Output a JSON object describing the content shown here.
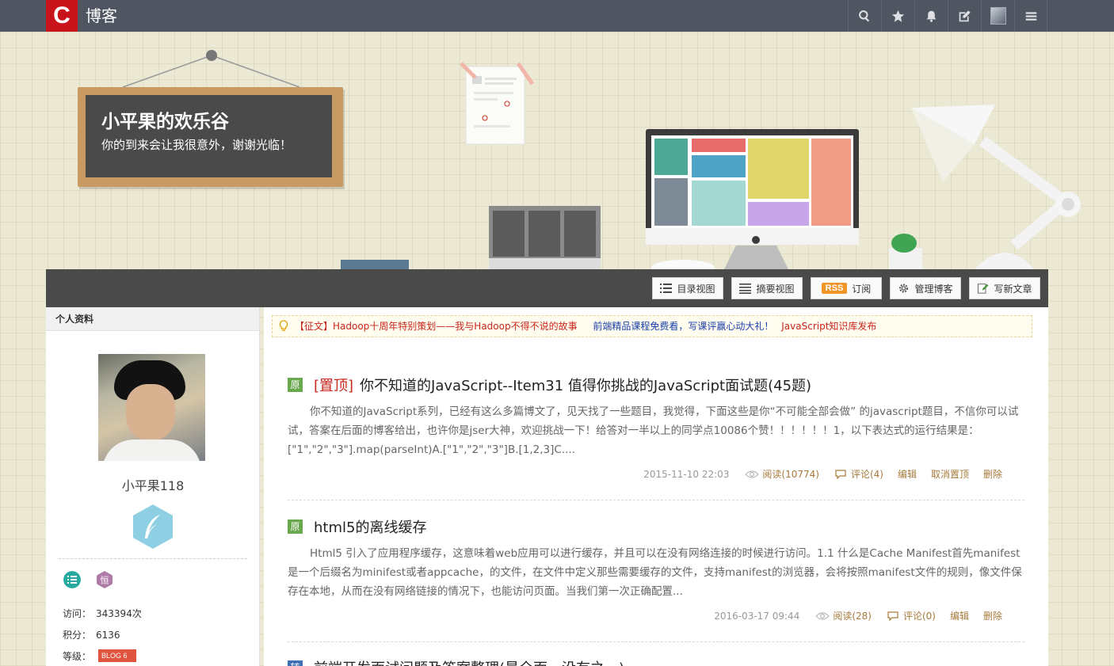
{
  "topbar": {
    "logo": "C",
    "site_title": "博客",
    "icons": [
      "search-icon",
      "star-icon",
      "bell-icon",
      "edit-icon",
      "user-avatar",
      "menu-icon"
    ]
  },
  "banner": {
    "blog_name": "小平果的欢乐谷",
    "blog_subtitle": "你的到来会让我很意外，谢谢光临！"
  },
  "toolbar": {
    "catalog_view": "目录视图",
    "summary_view": "摘要视图",
    "rss_badge": "RSS",
    "subscribe": "订阅",
    "manage_blog": "管理博客",
    "write_article": "写新文章"
  },
  "sidebar": {
    "section_title": "个人资料",
    "username": "小平果118",
    "visits_label": "访问：",
    "visits_value": "343394次",
    "points_label": "积分：",
    "points_value": "6136",
    "level_label": "等级：",
    "level_badge": "BLOG 6"
  },
  "notice": {
    "item1": "【征文】Hadoop十周年特别策划——我与Hadoop不得不说的故事",
    "item2": "前端精品课程免费看，写课评赢心动大礼！",
    "item3": "JavaScript知识库发布"
  },
  "articles": [
    {
      "badge": "原",
      "top_label": "[置顶]",
      "title": "你不知道的JavaScript--Item31 值得你挑战的JavaScript面试题(45题)",
      "summary": "你不知道的JavaScript系列，已经有这么多篇博文了，见天找了一些题目，我觉得，下面这些是你“不可能全部会做” 的javascript题目，不信你可以试试，答案在后面的博客给出，也许你是jser大神，欢迎挑战一下！给答对一半以上的同学点10086个赞！！！！！！1，以下表达式的运行结果是：[\"1\",\"2\",\"3\"].map(parseInt)A.[\"1\",\"2\",\"3\"]B.[1,2,3]C....",
      "date": "2015-11-10 22:03",
      "reads": "阅读(10774)",
      "comments": "评论(4)",
      "edit": "编辑",
      "untop": "取消置顶",
      "delete": "删除"
    },
    {
      "badge": "原",
      "title": "html5的离线缓存",
      "summary": "Html5 引入了应用程序缓存，这意味着web应用可以进行缓存，并且可以在没有网络连接的时候进行访问。1.1 什么是Cache Manifest首先manifest是一个后缀名为minifest或者appcache，的文件，在文件中定义那些需要缓存的文件，支持manifest的浏览器，会将按照manifest文件的规则，像文件保存在本地，从而在没有网络链接的情况下，也能访问页面。当我们第一次正确配置...",
      "date": "2016-03-17 09:44",
      "reads": "阅读(28)",
      "comments": "评论(0)",
      "edit": "编辑",
      "delete": "删除"
    },
    {
      "badge": "转",
      "title": "前端开发面试问题及答案整理(最全面，没有之一)"
    }
  ],
  "colors": {
    "topbar_bg": "#4f5661",
    "logo_red": "#c9131a",
    "original_badge": "#6aa84f",
    "top_label_red": "#c9261b",
    "meta_link": "#a77a3b"
  }
}
